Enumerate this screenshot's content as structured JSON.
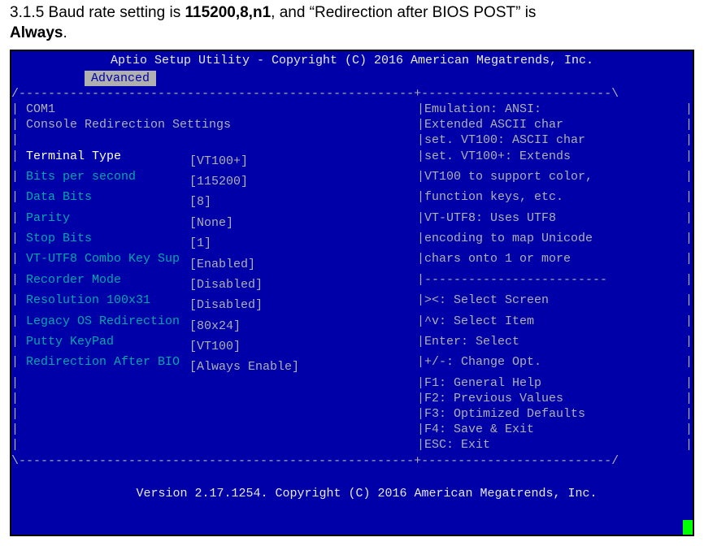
{
  "doc": {
    "section": "3.1.5",
    "text1": "  Baud rate setting is ",
    "baud": "115200,8,n1",
    "text2": ", and “Redirection after BIOS POST” is ",
    "always": "Always",
    "text3": "."
  },
  "bios": {
    "header": "Aptio Setup Utility - Copyright (C) 2016 American Megatrends, Inc.",
    "tab": "Advanced",
    "top_rule": "/------------------------------------------------------+--------------------------\\",
    "mid_rule_right": "-------------------------",
    "bot_rule": "\\------------------------------------------------------+--------------------------/",
    "left": {
      "head1": "COM1",
      "head2": "Console Redirection Settings",
      "rows": [
        {
          "label": "Terminal Type",
          "value": "[VT100+]",
          "selected": true
        },
        {
          "label": "Bits per second",
          "value": "[115200]"
        },
        {
          "label": "Data Bits",
          "value": "[8]"
        },
        {
          "label": "Parity",
          "value": "[None]"
        },
        {
          "label": "Stop Bits",
          "value": "[1]"
        },
        {
          "label": "VT-UTF8 Combo Key Sup",
          "value": "[Enabled]"
        },
        {
          "label": "Recorder Mode",
          "value": "[Disabled]"
        },
        {
          "label": "Resolution 100x31",
          "value": "[Disabled]"
        },
        {
          "label": "Legacy OS Redirection",
          "value": "[80x24]"
        },
        {
          "label": "Putty KeyPad",
          "value": "[VT100]"
        },
        {
          "label": "Redirection After BIO",
          "value": "[Always Enable]"
        }
      ]
    },
    "right": {
      "help": [
        "Emulation: ANSI:",
        "Extended ASCII char",
        "set. VT100: ASCII char",
        "set. VT100+: Extends",
        "VT100 to support color,",
        "function keys, etc.",
        "VT-UTF8: Uses UTF8",
        "encoding to map Unicode",
        "chars onto 1 or more"
      ],
      "keys": [
        "><: Select Screen",
        "^v: Select Item",
        "Enter: Select",
        "+/-: Change Opt.",
        "F1: General Help",
        "F2: Previous Values",
        "F3: Optimized Defaults",
        "F4: Save & Exit",
        "ESC: Exit"
      ]
    },
    "footer": "Version 2.17.1254. Copyright (C) 2016 American Megatrends, Inc."
  }
}
